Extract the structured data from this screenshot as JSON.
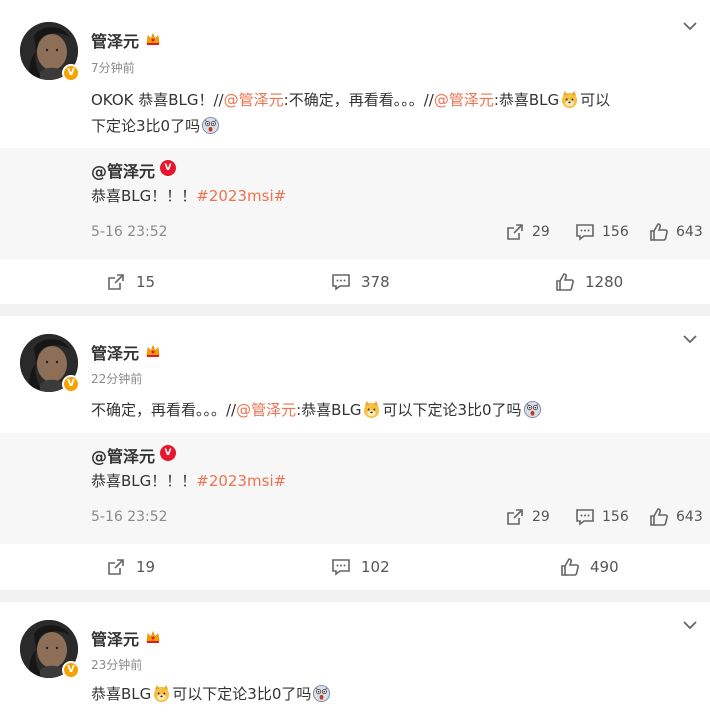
{
  "posts": [
    {
      "user": "管泽元",
      "time": "7分钟前",
      "text": {
        "p1": "OKOK 恭喜BLG！//",
        "m1": "@管泽元",
        "p2": ":不确定，再看看。。。//",
        "m2": "@管泽元",
        "p3": ":恭喜BLG",
        "p4": "可以",
        "line2a": "下定论3比0了吗"
      },
      "repost": {
        "user": "@管泽元",
        "text": "恭喜BLG！！！",
        "hashtag": "#2023msi#",
        "date": "5-16 23:52",
        "reposts": "29",
        "comments": "156",
        "likes": "643"
      },
      "actions": {
        "reposts": "15",
        "comments": "378",
        "likes": "1280"
      }
    },
    {
      "user": "管泽元",
      "time": "22分钟前",
      "text": {
        "p1": "不确定，再看看。。。//",
        "m1": "@管泽元",
        "p2": ":恭喜BLG",
        "p3": "可以下定论3比0了吗"
      },
      "repost": {
        "user": "@管泽元",
        "text": "恭喜BLG！！！",
        "hashtag": "#2023msi#",
        "date": "5-16 23:52",
        "reposts": "29",
        "comments": "156",
        "likes": "643"
      },
      "actions": {
        "reposts": "19",
        "comments": "102",
        "likes": "490"
      }
    },
    {
      "user": "管泽元",
      "time": "23分钟前",
      "text": {
        "p1": "恭喜BLG",
        "p2": "可以下定论3比0了吗"
      }
    }
  ],
  "colors": {
    "mention": "#eb7350",
    "verified": "#f5a300",
    "repost_bg": "#f7f7f7",
    "page_bg": "#f2f2f2"
  },
  "icons": [
    "chevron-down-icon",
    "crown-icon",
    "verified-badge-icon",
    "repost-icon",
    "comment-icon",
    "like-icon",
    "doge-emoji-icon",
    "shocked-emoji-icon"
  ]
}
